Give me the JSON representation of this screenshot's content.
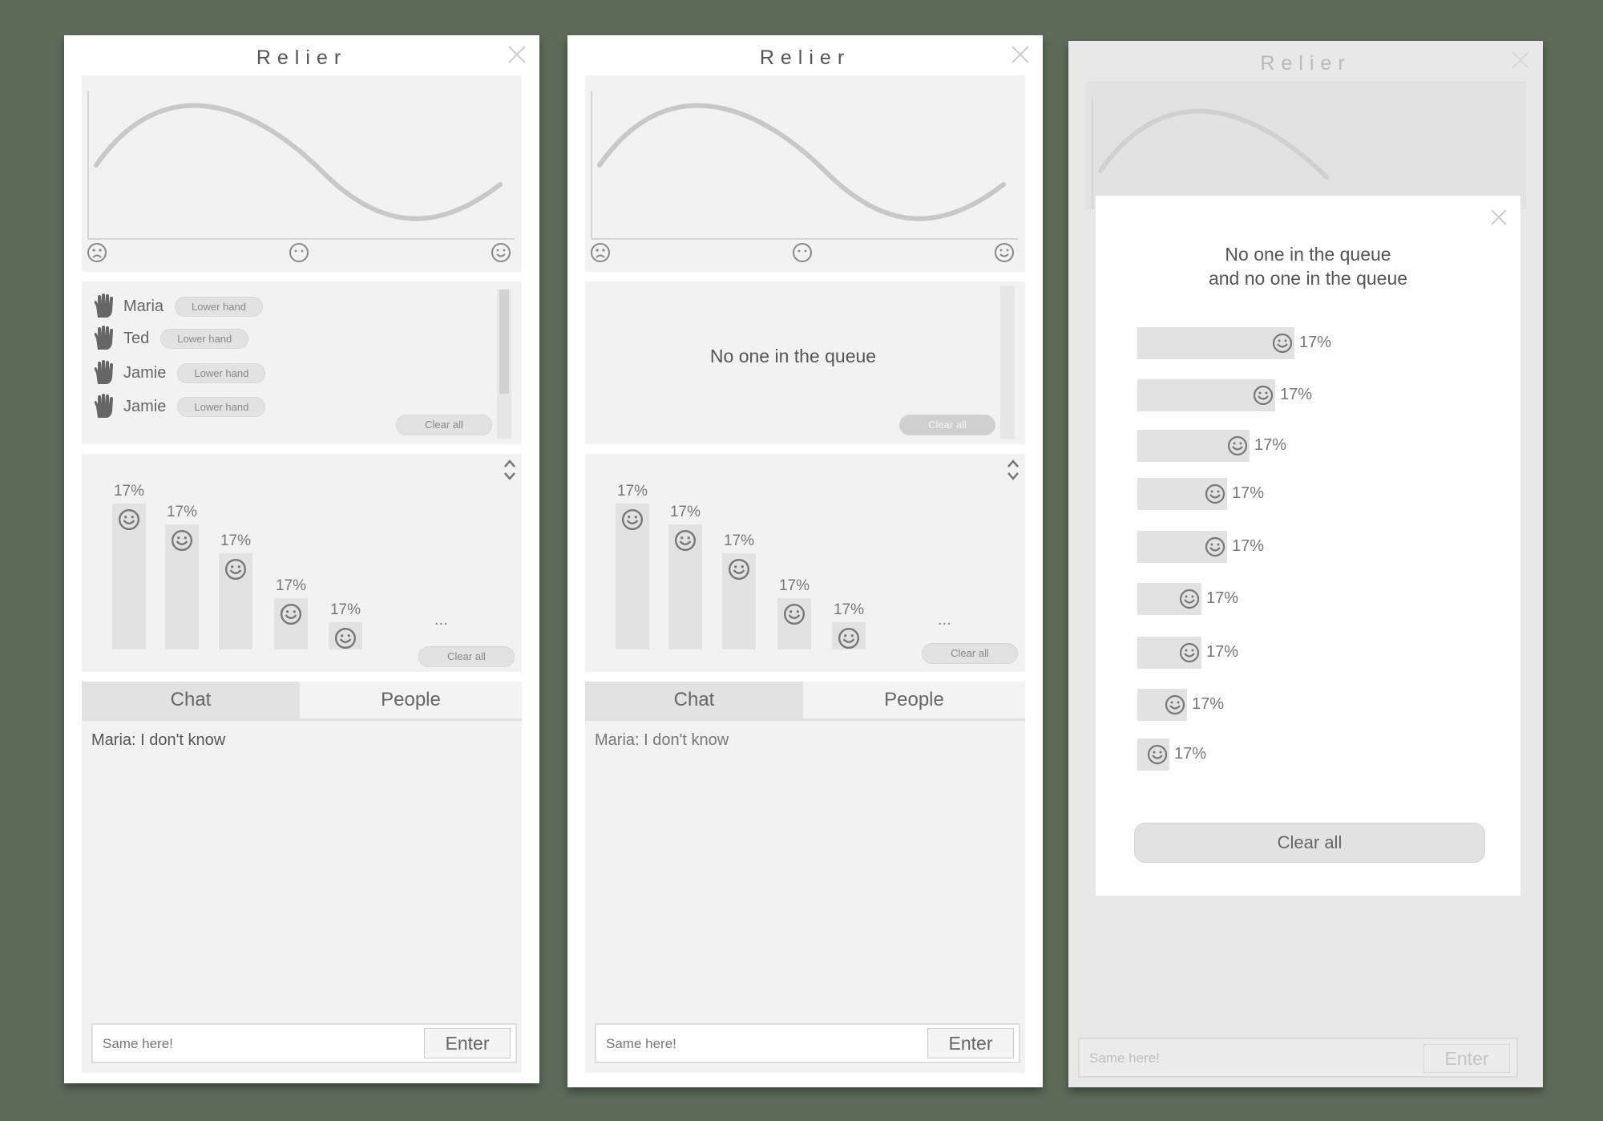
{
  "colors": {
    "background": "#5e6b59",
    "panel": "#f2f2f2",
    "bar": "#e2e2e2"
  },
  "panels": [
    {
      "title": "Relier",
      "queue": [
        {
          "name": "Maria",
          "button": "Lower hand"
        },
        {
          "name": "Ted",
          "button": "Lower hand"
        },
        {
          "name": "Jamie",
          "button": "Lower hand"
        },
        {
          "name": "Jamie",
          "button": "Lower hand"
        }
      ],
      "queue_clear": "Clear all",
      "bars": [
        "17%",
        "17%",
        "17%",
        "17%",
        "17%"
      ],
      "bars_more": "...",
      "bars_clear": "Clear all",
      "tabs": [
        "Chat",
        "People"
      ],
      "message": "Maria: I don't know",
      "input_value": "Same here!",
      "enter": "Enter"
    },
    {
      "title": "Relier",
      "queue_empty": "No one in the queue",
      "queue_clear": "Clear all",
      "bars": [
        "17%",
        "17%",
        "17%",
        "17%",
        "17%"
      ],
      "bars_more": "...",
      "bars_clear": "Clear all",
      "tabs": [
        "Chat",
        "People"
      ],
      "message": "Maria: I don't know",
      "input_value": "Same here!",
      "enter": "Enter"
    },
    {
      "title": "Relier",
      "input_value": "Same here!",
      "enter": "Enter",
      "modal": {
        "message_line1": "No one in the queue",
        "message_line2": "and no one in the queue",
        "bars": [
          "17%",
          "17%",
          "17%",
          "17%",
          "17%",
          "17%",
          "17%",
          "17%",
          "17%"
        ],
        "clear": "Clear all"
      }
    }
  ]
}
